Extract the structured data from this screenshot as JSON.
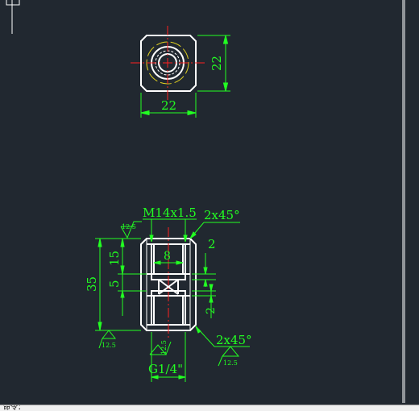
{
  "drawing": {
    "top_view": {
      "width_dim": "22",
      "height_dim": "22"
    },
    "side_view": {
      "thread_label": "M14x1.5",
      "chamfer_top": "2x45°",
      "chamfer_bottom": "2x45°",
      "dim_small_top": "2",
      "dim_small_bottom": "2",
      "dim_inner_8": "8",
      "dim_overall": "35",
      "dim_15": "15",
      "dim_5": "5",
      "pipe_thread": "G1/4\"",
      "roughness": [
        "12.5",
        "12.5",
        "12.5",
        "12.5"
      ]
    }
  },
  "colors": {
    "background": "#212830",
    "outline": "#ffffff",
    "dimension": "#22ff22",
    "centerline": "#ff2020",
    "hidden": "#e0d020"
  },
  "command_line": {
    "text": "命令："
  }
}
